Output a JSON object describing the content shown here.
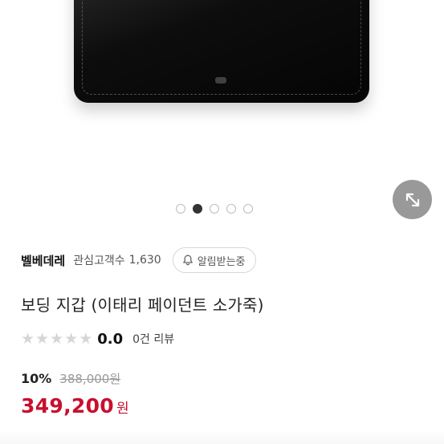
{
  "carousel": {
    "total": 5,
    "active_index": 1
  },
  "seller": {
    "name": "벨베데레",
    "favorites_label": "관심고객수",
    "favorites_count": "1,630",
    "notify_label": "알림받는중"
  },
  "product": {
    "title": "보딩 지갑 (이태리 페이던트 소가죽)",
    "rating": {
      "score": "0.0",
      "stars_filled": 0,
      "stars_total": 5,
      "review_text": "0건 리뷰"
    },
    "discount_rate": "10%",
    "original_price": "388,000원",
    "price": "349,200",
    "currency": "원"
  },
  "colors": {
    "price_red": "#c8102e",
    "star_empty": "#d6d6d6",
    "dot_active": "#333333"
  },
  "icons": {
    "expand": "expand-arrows-icon",
    "notify": "bell-icon",
    "star": "star-icon"
  }
}
